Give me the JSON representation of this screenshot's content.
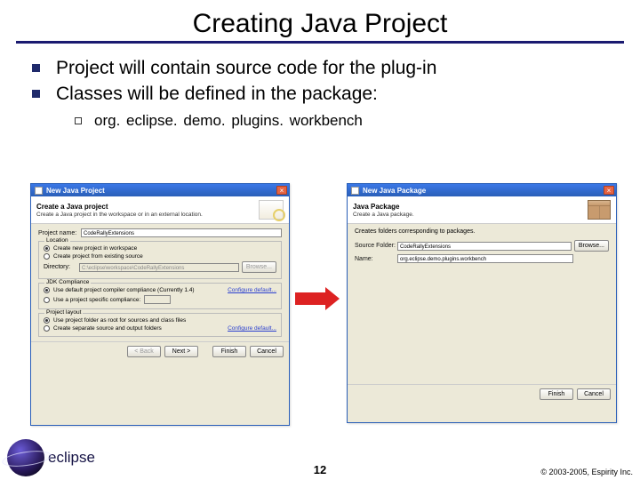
{
  "title": "Creating Java Project",
  "bullets": {
    "b1": "Project will contain source code for the plug-in",
    "b2": "Classes will be defined in the package:",
    "sub": "org. eclipse. demo. plugins. workbench"
  },
  "dlg1": {
    "titlebar": "New Java Project",
    "banner_title": "Create a Java project",
    "banner_sub": "Create a Java project in the workspace or in an external location.",
    "project_label": "Project name:",
    "project_value": "CodeRallyExtensions",
    "grp_location": "Location",
    "loc_r1": "Create new project in workspace",
    "loc_r2": "Create project from existing source",
    "dir_label": "Directory:",
    "dir_value": "C:\\eclipse\\workspace\\CodeRallyExtensions",
    "browse": "Browse...",
    "grp_jdk": "JDK Compliance",
    "jdk_r1": "Use default project compiler compliance (Currently 1.4)",
    "jdk_r2": "Use a project specific compliance:",
    "configure": "Configure default...",
    "grp_layout": "Project layout",
    "layout_r1": "Use project folder as root for sources and class files",
    "layout_r2": "Create separate source and output folders",
    "back": "< Back",
    "next": "Next >",
    "finish": "Finish",
    "cancel": "Cancel"
  },
  "dlg2": {
    "titlebar": "New Java Package",
    "banner_title": "Java Package",
    "banner_sub": "Create a Java package.",
    "hint": "Creates folders corresponding to packages.",
    "src_label": "Source Folder:",
    "src_value": "CodeRallyExtensions",
    "browse": "Browse...",
    "name_label": "Name:",
    "name_value": "org.eclipse.demo.plugins.workbench",
    "finish": "Finish",
    "cancel": "Cancel"
  },
  "footer": {
    "logo": "eclipse",
    "page": "12",
    "copyright": "© 2003-2005, Espirity Inc."
  }
}
